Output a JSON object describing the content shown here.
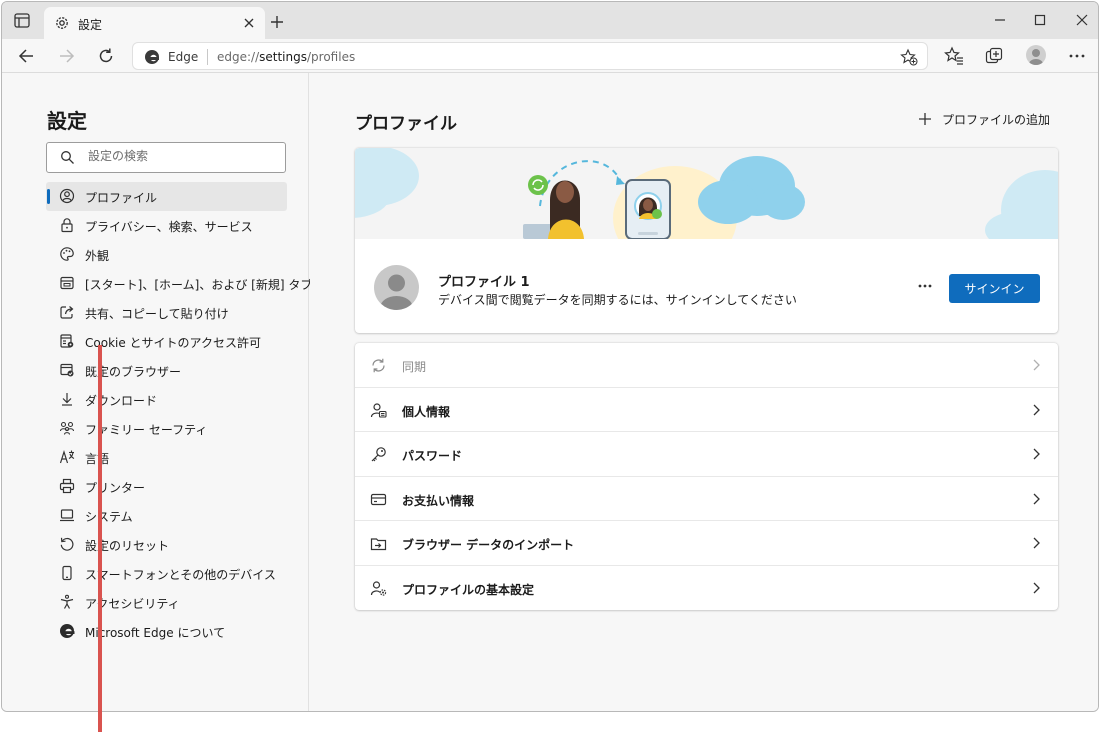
{
  "tab": {
    "title": "設定"
  },
  "address": {
    "site": "Edge",
    "url_prefix": "edge://",
    "url_path": "settings",
    "url_suffix": "/profiles"
  },
  "sidebar": {
    "title": "設定",
    "search_placeholder": "設定の検索",
    "items": [
      {
        "label": "プロファイル",
        "icon": "profile-icon",
        "active": true
      },
      {
        "label": "プライバシー、検索、サービス",
        "icon": "lock-icon"
      },
      {
        "label": "外観",
        "icon": "palette-icon"
      },
      {
        "label": "[スタート]、[ホーム]、および [新規] タブ",
        "icon": "home-tab-icon"
      },
      {
        "label": "共有、コピーして貼り付け",
        "icon": "share-icon"
      },
      {
        "label": "Cookie とサイトのアクセス許可",
        "icon": "cookie-site-icon"
      },
      {
        "label": "既定のブラウザー",
        "icon": "default-browser-icon"
      },
      {
        "label": "ダウンロード",
        "icon": "download-icon"
      },
      {
        "label": "ファミリー セーフティ",
        "icon": "family-icon"
      },
      {
        "label": "言語",
        "icon": "language-icon"
      },
      {
        "label": "プリンター",
        "icon": "printer-icon"
      },
      {
        "label": "システム",
        "icon": "laptop-icon"
      },
      {
        "label": "設定のリセット",
        "icon": "reset-icon"
      },
      {
        "label": "スマートフォンとその他のデバイス",
        "icon": "phone-icon"
      },
      {
        "label": "アクセシビリティ",
        "icon": "accessibility-icon"
      },
      {
        "label": "Microsoft Edge について",
        "icon": "edge-logo-icon"
      }
    ]
  },
  "main": {
    "title": "プロファイル",
    "add_profile": "プロファイルの追加",
    "profile": {
      "name": "プロファイル 1",
      "description": "デバイス間で閲覧データを同期するには、サインインしてください",
      "signin_label": "サインイン"
    },
    "rows": [
      {
        "label": "同期",
        "icon": "sync-icon",
        "disabled": true
      },
      {
        "label": "個人情報",
        "icon": "personal-info-icon"
      },
      {
        "label": "パスワード",
        "icon": "key-icon"
      },
      {
        "label": "お支払い情報",
        "icon": "card-icon"
      },
      {
        "label": "ブラウザー データのインポート",
        "icon": "import-icon"
      },
      {
        "label": "プロファイルの基本設定",
        "icon": "profile-settings-icon"
      }
    ]
  },
  "colors": {
    "accent": "#0f6cbd",
    "annotation_line": "#d9534f"
  }
}
